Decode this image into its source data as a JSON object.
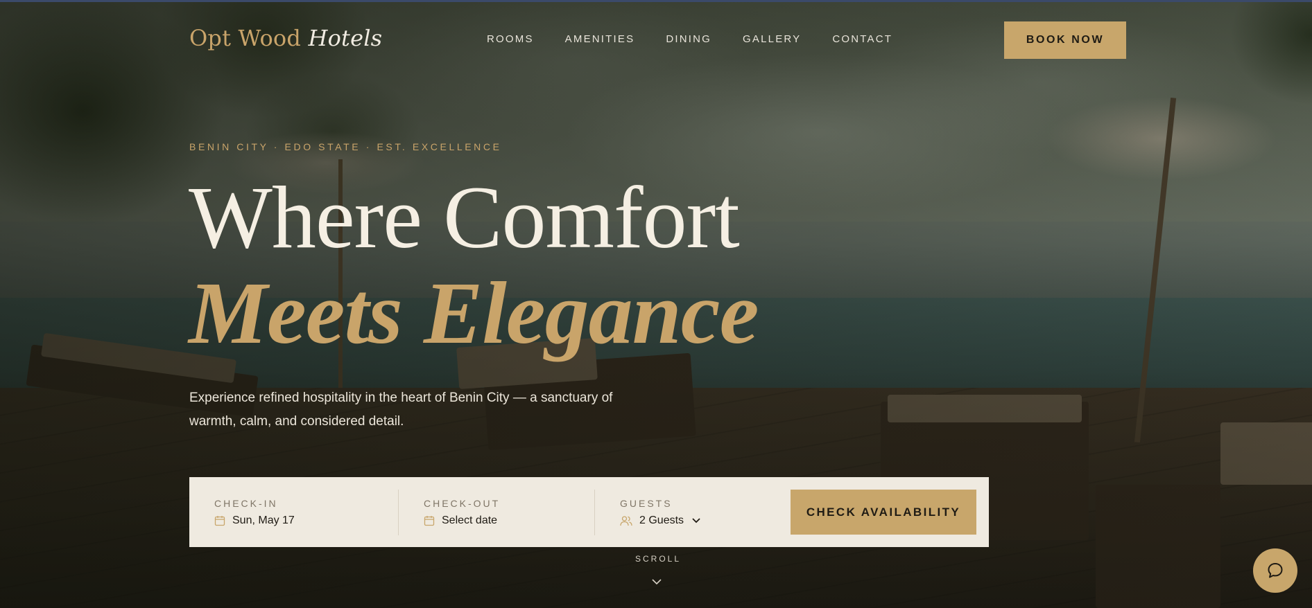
{
  "brand": {
    "name_plain": "Opt Wood",
    "name_italic": "Hotels"
  },
  "nav": {
    "items": [
      "ROOMS",
      "AMENITIES",
      "DINING",
      "GALLERY",
      "CONTACT"
    ]
  },
  "header": {
    "book_label": "BOOK NOW"
  },
  "hero": {
    "kicker": "BENIN CITY · EDO STATE · EST. EXCELLENCE",
    "title_line1": "Where Comfort",
    "title_line2": "Meets Elegance",
    "lead": "Experience refined hospitality in the heart of Benin City — a sanctuary of warmth, calm, and considered detail."
  },
  "booking": {
    "checkin": {
      "label": "CHECK-IN",
      "value": "Sun, May 17",
      "icon": "calendar-icon"
    },
    "checkout": {
      "label": "CHECK-OUT",
      "value": "Select date",
      "icon": "calendar-icon"
    },
    "guests": {
      "label": "GUESTS",
      "value": "2 Guests",
      "icon": "users-icon"
    },
    "submit_label": "CHECK AVAILABILITY"
  },
  "scroll": {
    "label": "SCROLL"
  },
  "colors": {
    "accent": "#c8a66b",
    "ink": "#1f1b14",
    "cream": "#efeae0",
    "light_text": "#f5efe3"
  }
}
